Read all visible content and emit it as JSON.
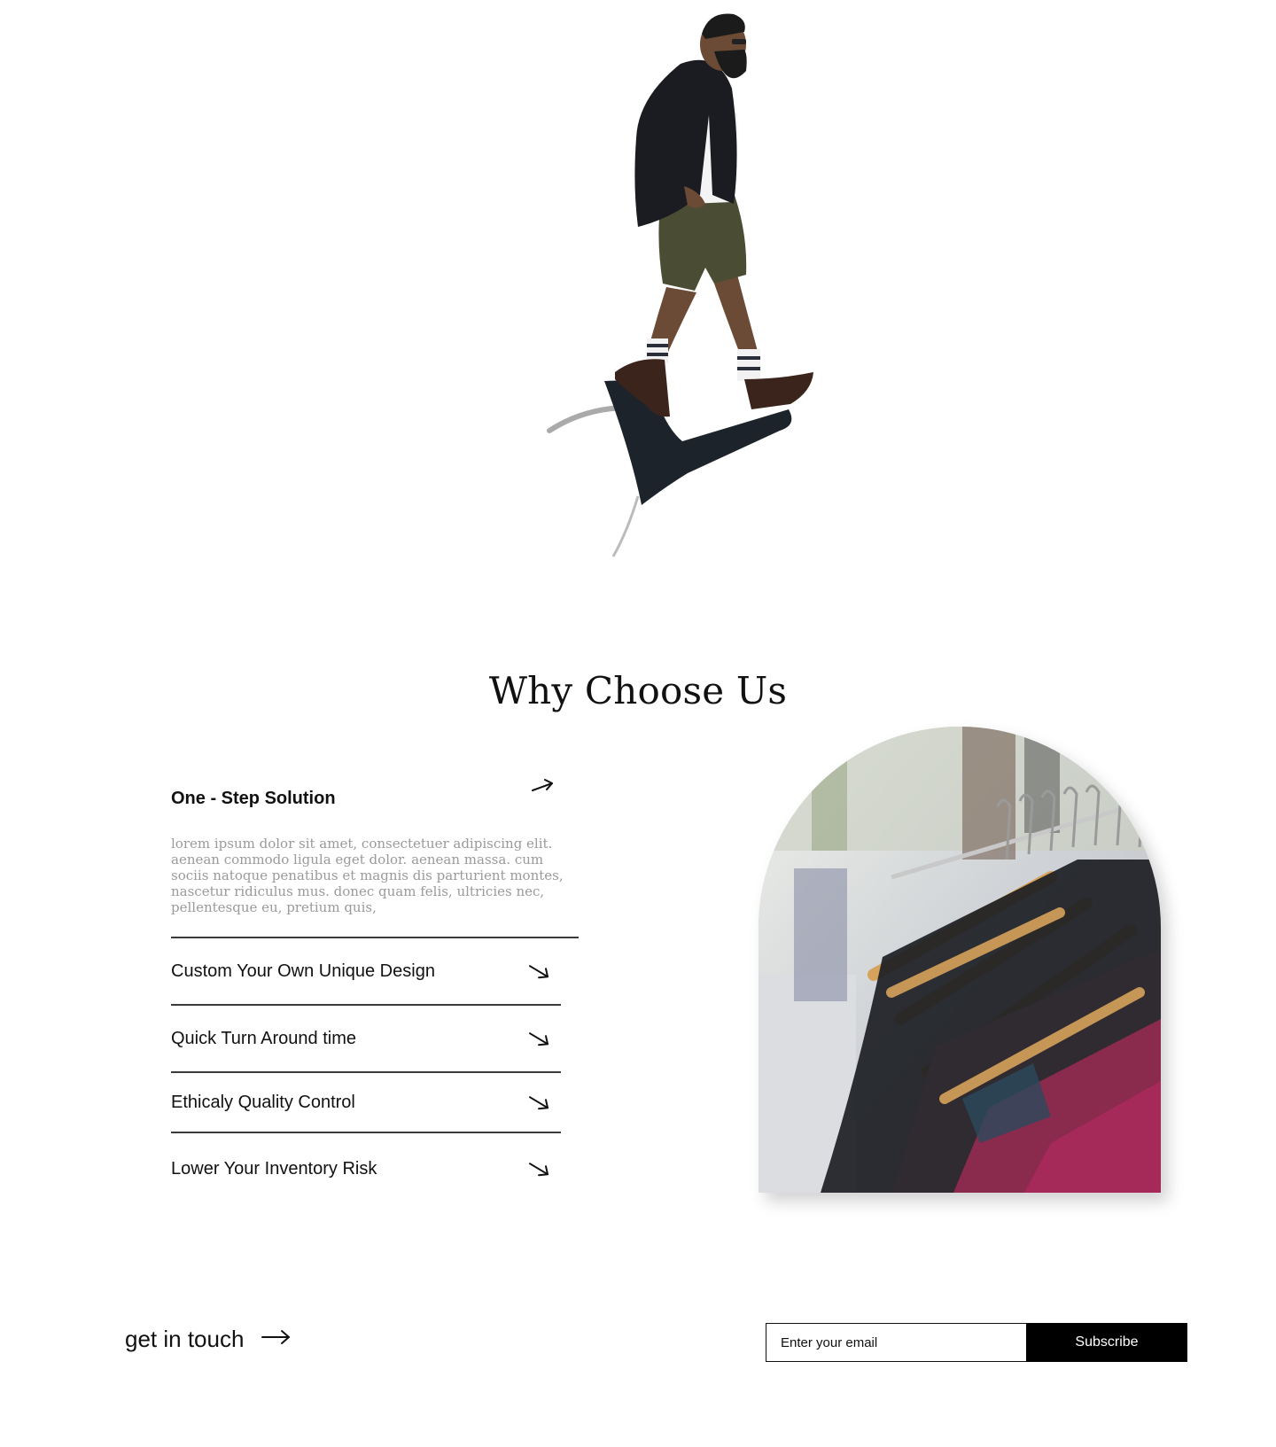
{
  "colors": {
    "text": "#111111",
    "muted_text": "#9a9a9a",
    "divider": "#3a3a3a",
    "button_bg": "#000000",
    "button_text": "#ffffff",
    "page_bg": "#ffffff"
  },
  "hero": {
    "image": "man-jumping-icon"
  },
  "why_choose_us": {
    "title": "Why Choose Us",
    "features": [
      {
        "title": "One - Step Solution",
        "description": "lorem ipsum dolor sit amet, consectetuer adipiscing elit. aenean commodo ligula eget dolor. aenean massa. cum sociis natoque penatibus et magnis dis parturient montes, nascetur ridiculus mus. donec quam felis, ultricies nec, pellentesque eu, pretium quis,",
        "expanded": true,
        "icon": "arrow-up-right-icon"
      },
      {
        "title": "Custom Your Own Unique Design",
        "expanded": false,
        "icon": "arrow-down-right-icon"
      },
      {
        "title": "Quick Turn Around time",
        "expanded": false,
        "icon": "arrow-down-right-icon"
      },
      {
        "title": "Ethicaly Quality Control",
        "expanded": false,
        "icon": "arrow-down-right-icon"
      },
      {
        "title": "Lower Your Inventory Risk",
        "expanded": false,
        "icon": "arrow-down-right-icon"
      }
    ],
    "image": "clothing-rack-icon"
  },
  "footer": {
    "get_in_touch": "get in touch",
    "email_placeholder": "Enter your email",
    "subscribe_label": "Subscribe"
  }
}
